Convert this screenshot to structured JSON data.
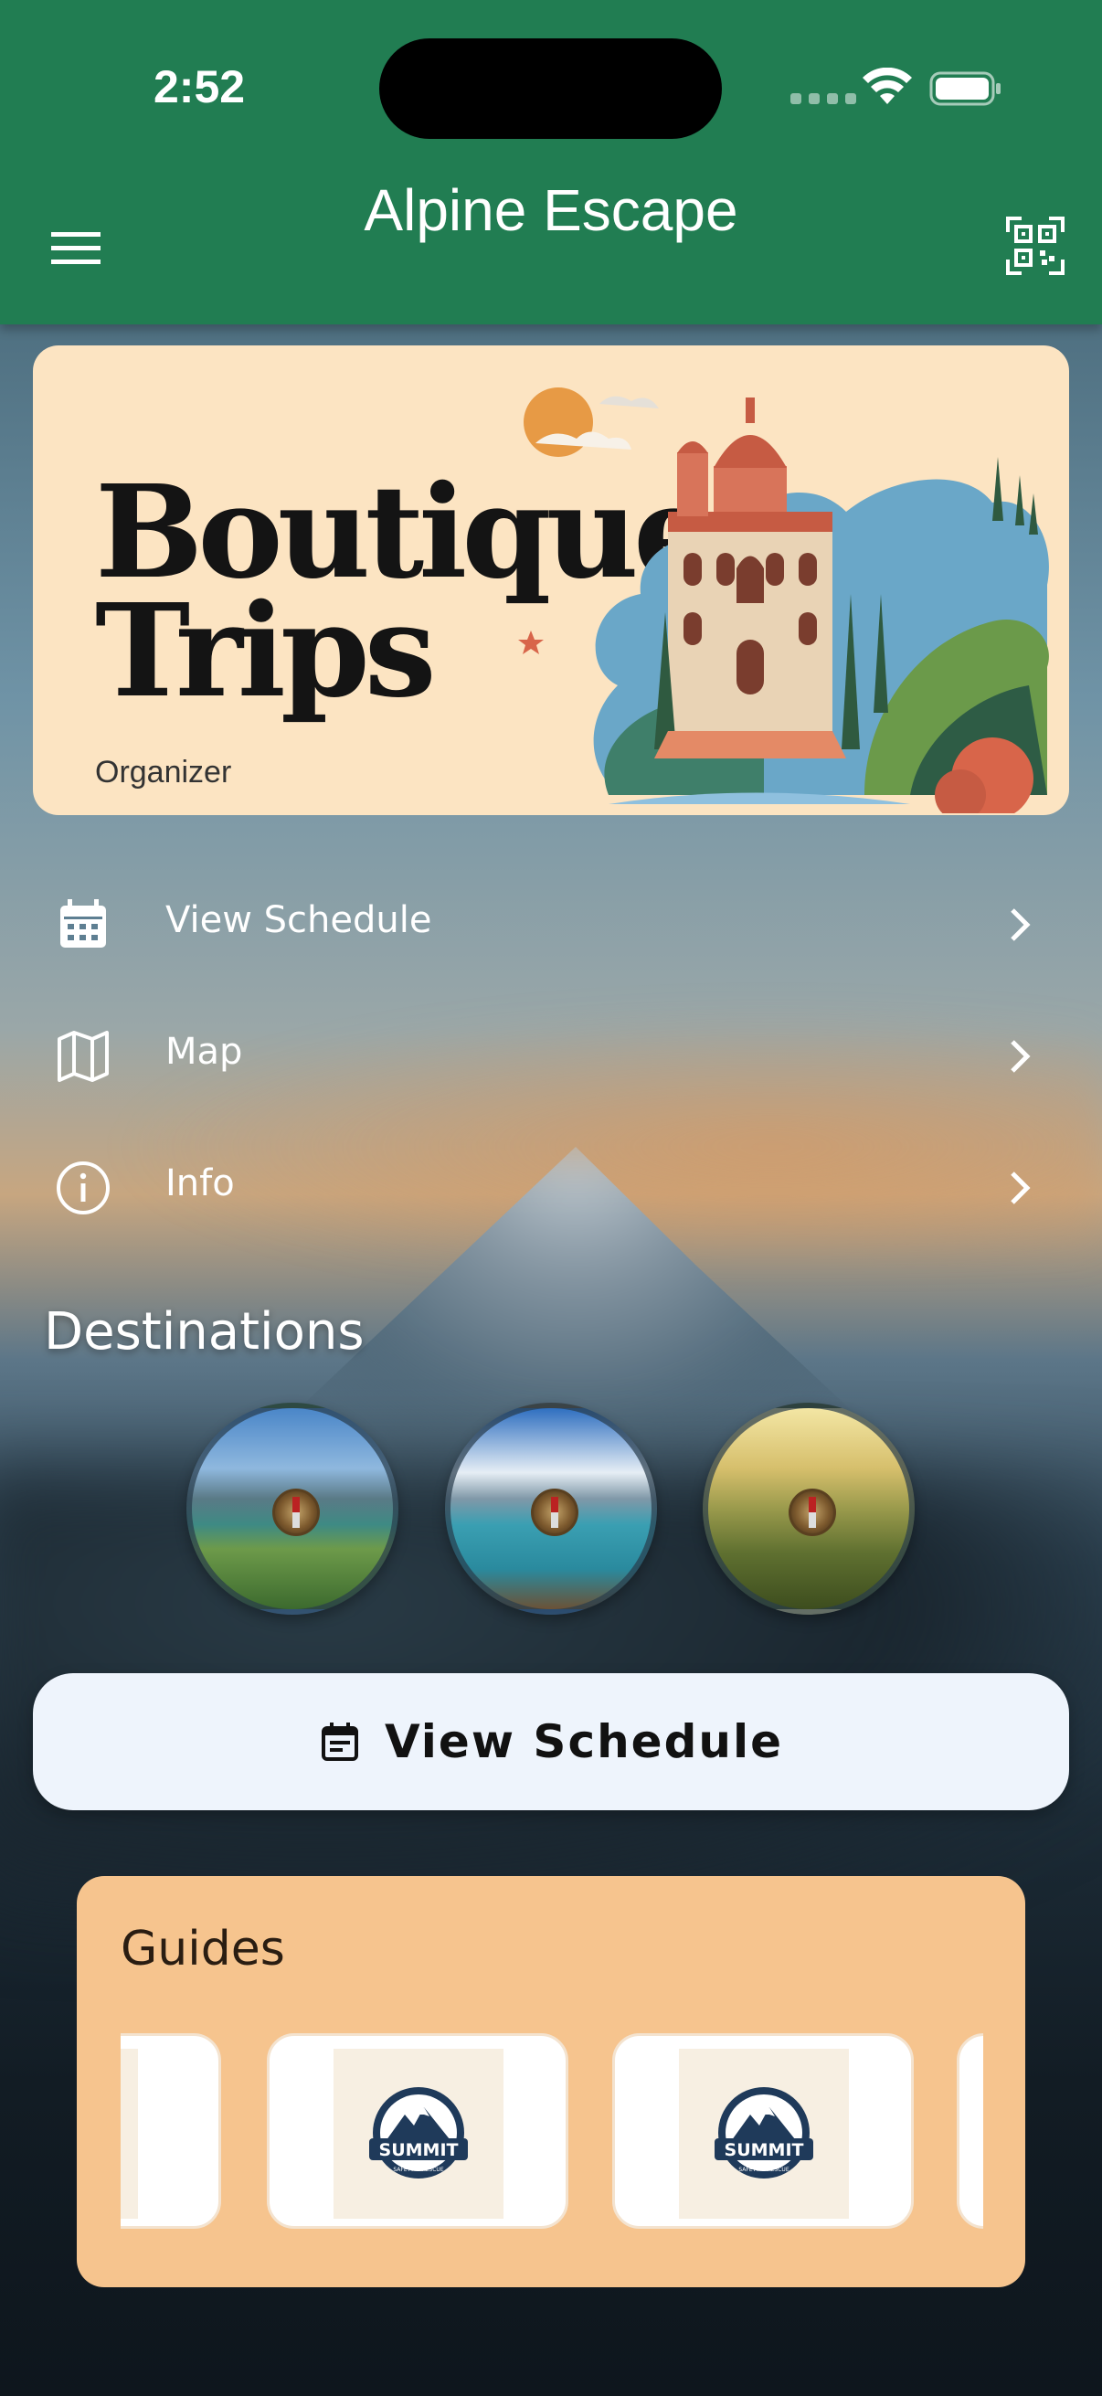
{
  "status_bar": {
    "time": "2:52"
  },
  "app_bar": {
    "title": "Alpine Escape",
    "menu_icon": "hamburger-menu-icon",
    "scan_icon": "qr-scan-icon",
    "color": "#217d52"
  },
  "banner": {
    "title_line1": "Boutique",
    "title_line2": "Trips",
    "subtitle": "Organizer"
  },
  "menu": [
    {
      "label": "View Schedule",
      "icon": "calendar-icon"
    },
    {
      "label": "Map",
      "icon": "map-icon"
    },
    {
      "label": "Info",
      "icon": "info-icon"
    }
  ],
  "destinations": {
    "title": "Destinations",
    "items": [
      {
        "scene": "mountain-valley-lake"
      },
      {
        "scene": "mountain-lake-dock"
      },
      {
        "scene": "forest-valley-sunlight"
      }
    ]
  },
  "cta": {
    "label": "View Schedule",
    "icon": "event-note-icon"
  },
  "guides": {
    "title": "Guides",
    "cards": [
      {
        "logo_text": "SUMMIT",
        "logo_sub": "SAFETY & RESCUE"
      },
      {
        "logo_text": "SUMMIT",
        "logo_sub": "SAFETY & RESCUE"
      }
    ]
  }
}
